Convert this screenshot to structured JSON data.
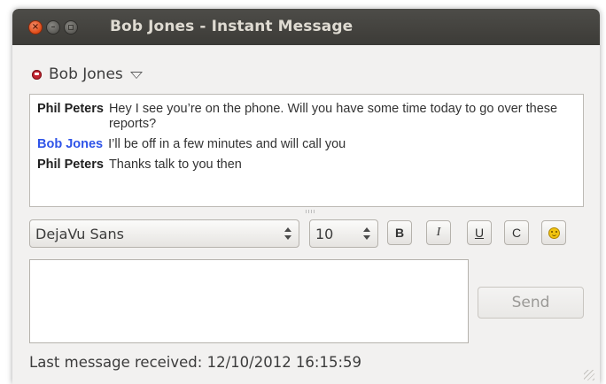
{
  "window": {
    "title": "Bob Jones - Instant Message"
  },
  "contact": {
    "name": "Bob Jones",
    "status_icon": "busy-status-icon",
    "status_color": "#c2232f"
  },
  "messages": [
    {
      "sender": "Phil Peters",
      "text": "Hey I see you’re on the phone. Will you have some time today to go over these reports?",
      "self": false
    },
    {
      "sender": "Bob Jones",
      "text": "I’ll be off in a few minutes and will call you",
      "self": true
    },
    {
      "sender": "Phil Peters",
      "text": "Thanks talk to you then",
      "self": false
    }
  ],
  "toolbar": {
    "font": "DejaVu Sans",
    "size": "10",
    "bold_label": "B",
    "italic_label": "I",
    "underline_label": "U",
    "color_label": "C",
    "emoticon_icon": "smiley-icon"
  },
  "compose": {
    "value": "",
    "send_label": "Send"
  },
  "footer": {
    "status": "Last message received: 12/10/2012 16:15:59"
  },
  "colors": {
    "self_name": "#2f54e8",
    "close_button": "#df4a16",
    "titlebar": "#3c3b37"
  }
}
